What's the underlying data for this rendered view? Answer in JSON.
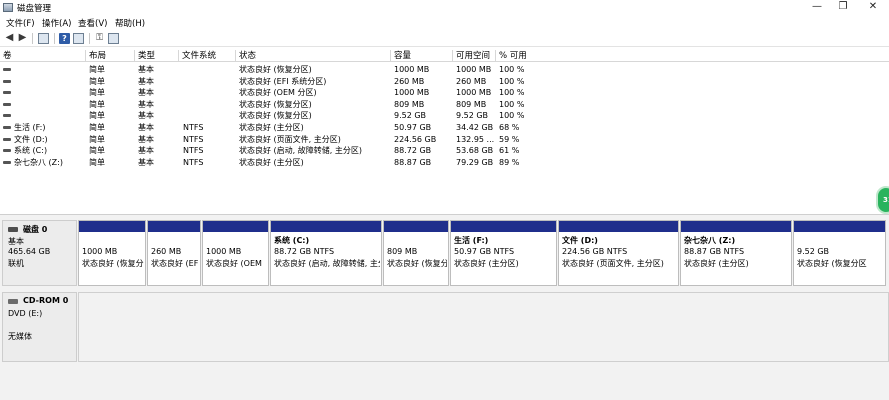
{
  "window": {
    "title": "磁盘管理"
  },
  "menu": [
    {
      "label": "文件(F)"
    },
    {
      "label": "操作(A)"
    },
    {
      "label": "查看(V)"
    },
    {
      "label": "帮助(H)"
    }
  ],
  "toolbar": {
    "icons": [
      "back-arrow-icon",
      "forward-arrow-icon",
      "up-pane-icon",
      "help-icon",
      "properties-icon",
      "key-icon",
      "list-view-icon"
    ]
  },
  "volume_list": {
    "columns": [
      "卷",
      "布局",
      "类型",
      "文件系统",
      "状态",
      "容量",
      "可用空间",
      "% 可用"
    ],
    "rows": [
      [
        "",
        "简单",
        "基本",
        "",
        "状态良好 (恢复分区)",
        "1000 MB",
        "1000 MB",
        "100 %"
      ],
      [
        "",
        "简单",
        "基本",
        "",
        "状态良好 (EFI 系统分区)",
        "260 MB",
        "260 MB",
        "100 %"
      ],
      [
        "",
        "简单",
        "基本",
        "",
        "状态良好 (OEM 分区)",
        "1000 MB",
        "1000 MB",
        "100 %"
      ],
      [
        "",
        "简单",
        "基本",
        "",
        "状态良好 (恢复分区)",
        "809 MB",
        "809 MB",
        "100 %"
      ],
      [
        "",
        "简单",
        "基本",
        "",
        "状态良好 (恢复分区)",
        "9.52 GB",
        "9.52 GB",
        "100 %"
      ],
      [
        "生活 (F:)",
        "简单",
        "基本",
        "NTFS",
        "状态良好 (主分区)",
        "50.97 GB",
        "34.42 GB",
        "68 %"
      ],
      [
        "文件 (D:)",
        "简单",
        "基本",
        "NTFS",
        "状态良好 (页面文件, 主分区)",
        "224.56 GB",
        "132.95 ...",
        "59 %"
      ],
      [
        "系统 (C:)",
        "简单",
        "基本",
        "NTFS",
        "状态良好 (启动, 故障转储, 主分区)",
        "88.72 GB",
        "53.68 GB",
        "61 %"
      ],
      [
        "杂七杂八 (Z:)",
        "简单",
        "基本",
        "NTFS",
        "状态良好 (主分区)",
        "88.87 GB",
        "79.29 GB",
        "89 %"
      ]
    ]
  },
  "edge_badge": {
    "text": "31"
  },
  "disk0": {
    "name": "磁盘 0",
    "type": "基本",
    "size": "465.64 GB",
    "status": "联机",
    "partitions": [
      {
        "name": "",
        "size": "1000 MB",
        "status": "状态良好 (恢复分"
      },
      {
        "name": "",
        "size": "260 MB",
        "status": "状态良好 (EF"
      },
      {
        "name": "",
        "size": "1000 MB",
        "status": "状态良好 (OEM"
      },
      {
        "name": "系统 (C:)",
        "size": "88.72 GB NTFS",
        "status": "状态良好 (启动, 故障转储, 主分"
      },
      {
        "name": "",
        "size": "809 MB",
        "status": "状态良好 (恢复分"
      },
      {
        "name": "生活 (F:)",
        "size": "50.97 GB NTFS",
        "status": "状态良好 (主分区)"
      },
      {
        "name": "文件 (D:)",
        "size": "224.56 GB NTFS",
        "status": "状态良好 (页面文件, 主分区)"
      },
      {
        "name": "杂七杂八 (Z:)",
        "size": "88.87 GB NTFS",
        "status": "状态良好 (主分区)"
      },
      {
        "name": "",
        "size": "9.52 GB",
        "status": "状态良好 (恢复分区"
      }
    ]
  },
  "cdrom0": {
    "name": "CD-ROM 0",
    "drive": "DVD (E:)",
    "status": "无媒体"
  },
  "colors": {
    "partition_bar": "#1f2e8c",
    "badge": "#29b35d"
  }
}
